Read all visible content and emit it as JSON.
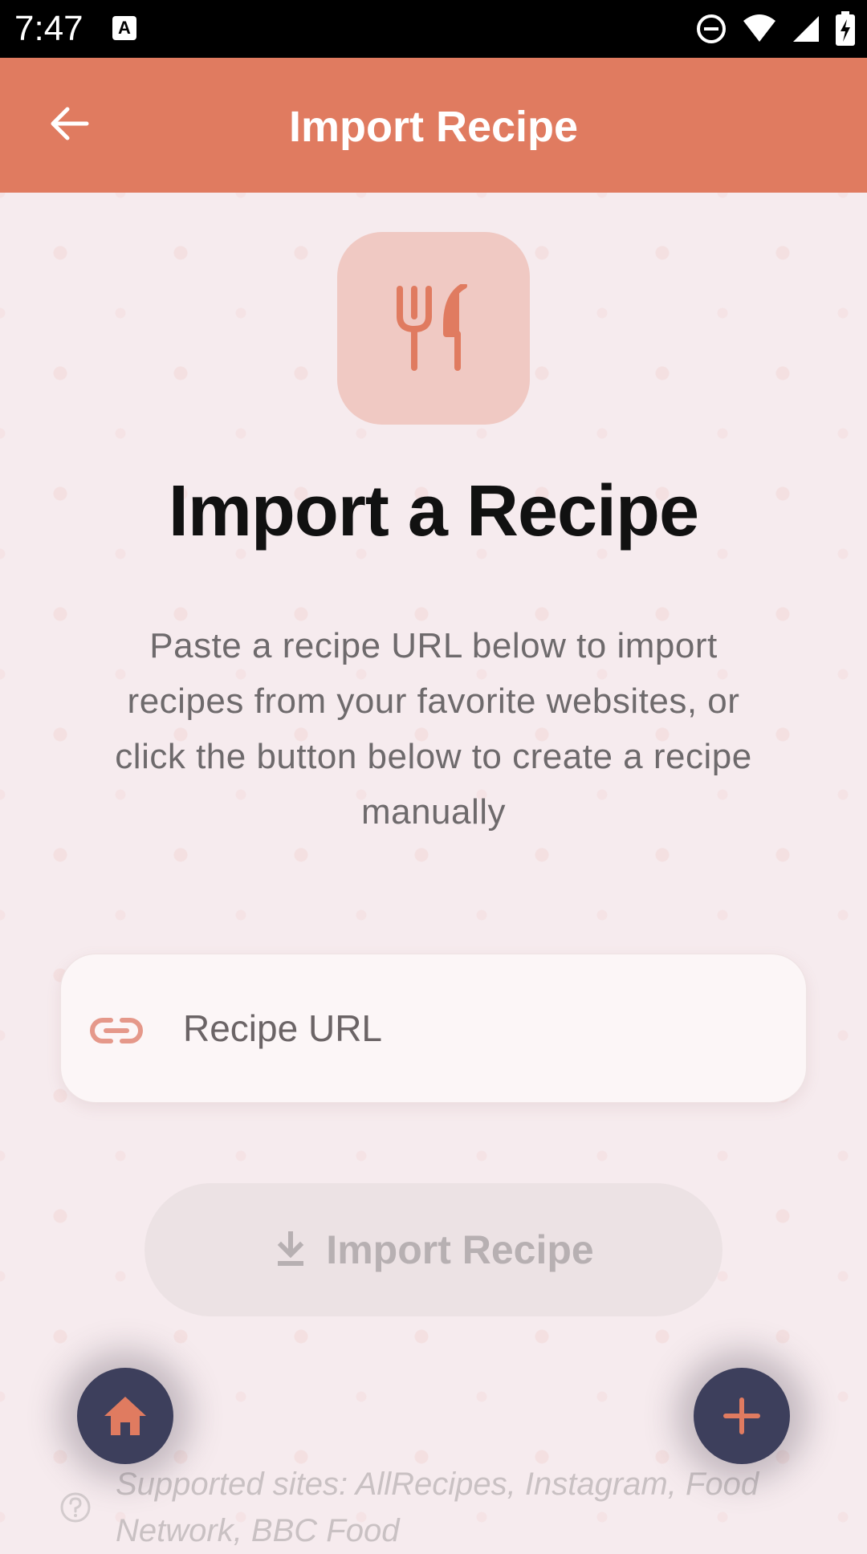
{
  "status_bar": {
    "time": "7:47",
    "notification_icon": "A",
    "icons": [
      "do-not-disturb-icon",
      "wifi-icon",
      "cell-signal-icon",
      "battery-charging-icon"
    ]
  },
  "app_bar": {
    "title": "Import Recipe",
    "back_icon": "arrow-back-icon",
    "color": "#e07b60"
  },
  "hero": {
    "icon": "fork-knife-icon",
    "title": "Import a Recipe",
    "description": "Paste a recipe URL below to import recipes from your favorite websites, or click the button below to create a recipe manually"
  },
  "url_field": {
    "icon": "link-icon",
    "placeholder": "Recipe URL",
    "value": ""
  },
  "import_button": {
    "icon": "download-icon",
    "label": "Import Recipe",
    "enabled": false
  },
  "supported": {
    "icon": "help-circle-icon",
    "text": "Supported sites: AllRecipes, Instagram, Food Network, BBC Food"
  },
  "fabs": {
    "home_icon": "home-icon",
    "add_icon": "plus-icon"
  },
  "colors": {
    "accent": "#e07b60",
    "fab_background": "#3d3f5c",
    "background": "#f6ebee"
  }
}
